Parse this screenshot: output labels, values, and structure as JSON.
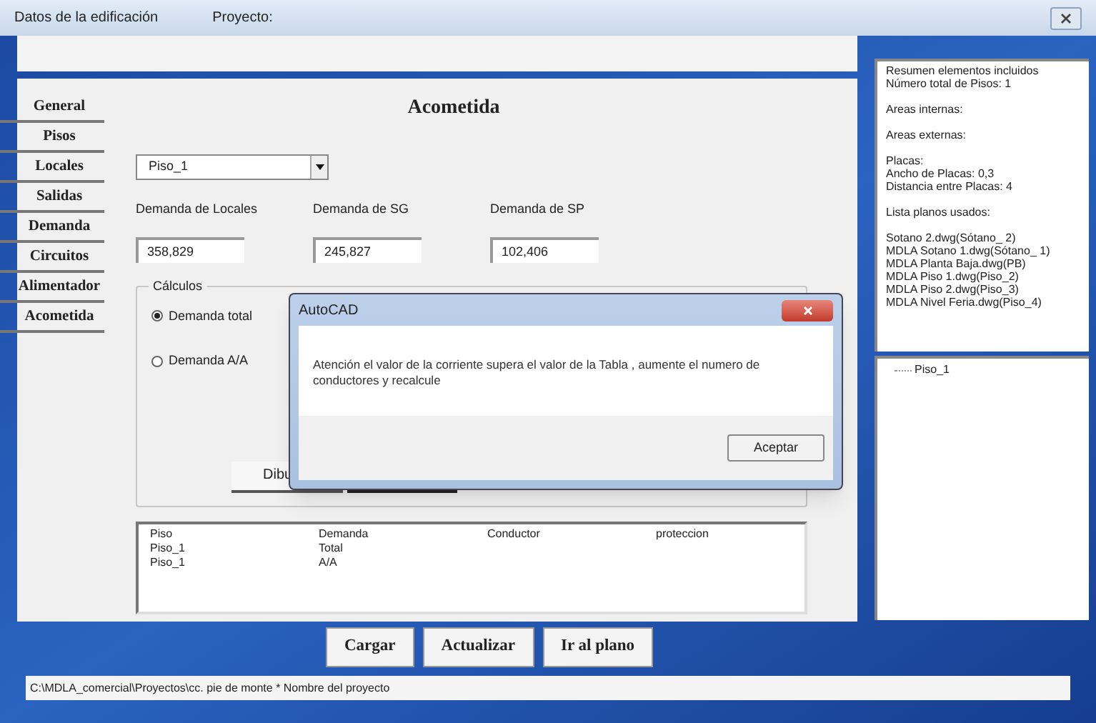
{
  "window": {
    "title": "Datos de la edificación",
    "project_label": "Proyecto:"
  },
  "sidebar": {
    "items": [
      {
        "label": "General"
      },
      {
        "label": "Pisos"
      },
      {
        "label": "Locales"
      },
      {
        "label": "Salidas"
      },
      {
        "label": "Demanda"
      },
      {
        "label": "Circuitos"
      },
      {
        "label": "Alimentador"
      },
      {
        "label": "Acometida"
      }
    ]
  },
  "form": {
    "heading": "Acometida",
    "floor_select": {
      "value": "Piso_1"
    },
    "fields": [
      {
        "label": "Demanda de Locales",
        "value": "358,829"
      },
      {
        "label": "Demanda de SG",
        "value": "245,827"
      },
      {
        "label": "Demanda de SP",
        "value": "102,406"
      }
    ],
    "calculos": {
      "legend": "Cálculos",
      "options": [
        {
          "label": "Demanda total",
          "selected": true
        },
        {
          "label": "Demanda A/A",
          "selected": false
        }
      ],
      "draw_button": "Dibu"
    },
    "results": {
      "columns": [
        "Piso",
        "Demanda",
        "Conductor",
        "proteccion"
      ],
      "rows": [
        [
          "Piso_1",
          "Total"
        ],
        [
          "Piso_1",
          "A/A"
        ]
      ]
    }
  },
  "summary": {
    "paragraphs": [
      [
        "Resumen elementos incluidos",
        "Número total de Pisos:  1"
      ],
      [
        "Areas internas:"
      ],
      [
        "Areas externas:"
      ],
      [
        "Placas:",
        "Ancho de Placas: 0,3",
        "Distancia entre Placas: 4"
      ],
      [
        "Lista planos usados:"
      ],
      [
        "Sotano 2.dwg(Sótano_ 2)",
        "MDLA Sotano 1.dwg(Sótano_ 1)",
        "MDLA Planta Baja.dwg(PB)",
        "MDLA Piso 1.dwg(Piso_2)",
        "MDLA Piso 2.dwg(Piso_3)",
        "MDLA Nivel Feria.dwg(Piso_4)"
      ]
    ]
  },
  "tree": {
    "items": [
      {
        "label": "Piso_1"
      }
    ]
  },
  "buttons": [
    "Cargar",
    "Actualizar",
    "Ir al plano"
  ],
  "status_bar": "C:\\MDLA_comercial\\Proyectos\\cc. pie de monte * Nombre del proyecto",
  "dialog": {
    "title": "AutoCAD",
    "message": "Atención el valor de la corriente supera el valor de la Tabla , aumente el numero de conductores y recalcule",
    "buttons": [
      "Aceptar"
    ]
  }
}
